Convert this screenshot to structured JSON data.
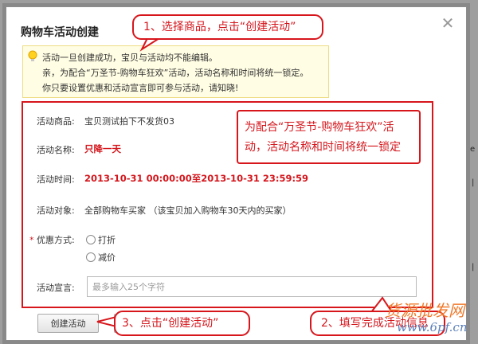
{
  "background": {
    "fragments": [
      "e",
      "|",
      "|"
    ]
  },
  "dialog": {
    "title": "购物车活动创建",
    "close_glyph": "✕"
  },
  "tip": {
    "line1": "活动一旦创建成功，宝贝与活动均不能编辑。",
    "line2": "亲，为配合“万圣节-购物车狂欢”活动，活动名称和时间将统一锁定。",
    "line3": "你只要设置优惠和活动宣言即可参与活动，请知晓!"
  },
  "form": {
    "product": {
      "label": "活动商品:",
      "value": "宝贝测试拍下不发货03"
    },
    "name": {
      "label": "活动名称:",
      "value": "只降一天"
    },
    "time": {
      "label": "活动时间:",
      "start": "2013-10-31 00:00:00",
      "sep": "至",
      "end": "2013-10-31 23:59:59"
    },
    "target": {
      "label": "活动对象:",
      "value": "全部购物车买家 （该宝贝加入购物车30天内的买家）"
    },
    "discount": {
      "required_mark": "*",
      "label": "优惠方式:",
      "options": [
        "打折",
        "减价"
      ]
    },
    "slogan": {
      "label": "活动宣言:",
      "placeholder": "最多输入25个字符"
    }
  },
  "buttons": {
    "create": "创建活动",
    "cancel": ""
  },
  "callouts": {
    "step1": "1、选择商品，点击“创建活动”",
    "lock_line1": "为配合“万圣节-购物车狂欢”活",
    "lock_line2": "动，活动名称和时间将统一锁定",
    "step3": "3、点击“创建活动”",
    "step2": "2、填写完成活动信息"
  },
  "watermark": {
    "top": "货源批发网",
    "bottom": "www.6pf.cn"
  },
  "colors": {
    "accent_red": "#d7161c",
    "tip_bg": "#fffde3"
  }
}
